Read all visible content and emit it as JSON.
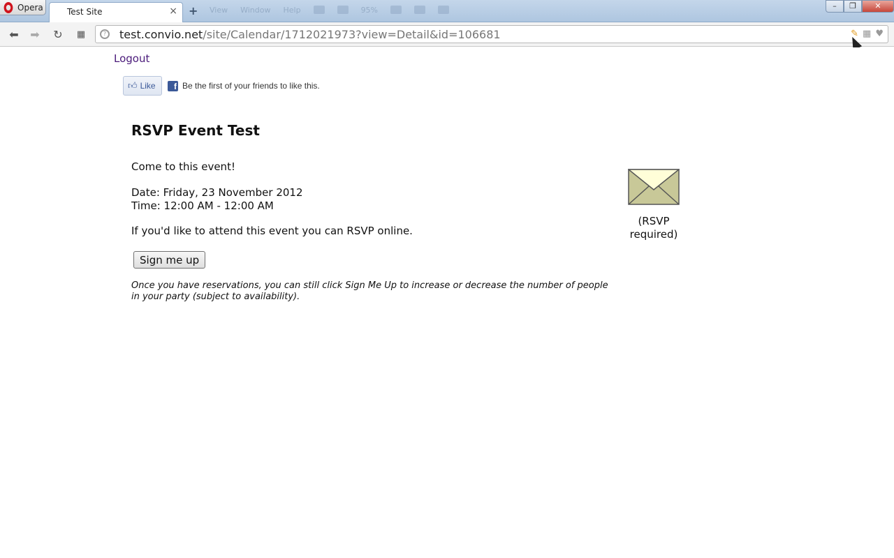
{
  "browser": {
    "menu_label": "Opera",
    "tab_title": "Test Site",
    "tab_close": "×",
    "new_tab": "+",
    "ghost_toolbar": [
      "View",
      "Window",
      "Help",
      "95%"
    ],
    "address": {
      "host": "test.convio.net",
      "path": "/site/Calendar/1712021973?view=Detail&id=106681"
    },
    "window_buttons": {
      "minimize": "–",
      "maximize": "❐",
      "close": "✕"
    }
  },
  "page": {
    "logout_label": "Logout",
    "facebook": {
      "like_label": "Like",
      "like_text": "Be the first of your friends to like this."
    },
    "event": {
      "title": "RSVP Event Test",
      "description": "Come to this event!",
      "date": "Date: Friday, 23 November 2012",
      "time": "Time: 12:00 AM - 12:00 AM",
      "rsvp_prompt": "If you'd like to attend this event you can RSVP online.",
      "signup_label": "Sign me up",
      "note": "Once you have reservations, you can still click Sign Me Up to increase or decrease the number of people in your party (subject to availability).",
      "rsvp_status_line1": "(RSVP",
      "rsvp_status_line2": "required)"
    }
  },
  "colors": {
    "link": "#4a1a7a",
    "facebook_blue": "#3b5998",
    "envelope_fill": "#c8c898",
    "envelope_flap": "#fffed8",
    "titlebar": "#b8cde4"
  },
  "icons": [
    "opera-logo-icon",
    "back-icon",
    "forward-icon",
    "reload-icon",
    "speed-dial-icon",
    "site-info-icon",
    "edit-pen-icon",
    "grid-icon",
    "heart-icon",
    "thumbs-up-icon",
    "facebook-icon",
    "envelope-icon",
    "cursor-icon"
  ]
}
